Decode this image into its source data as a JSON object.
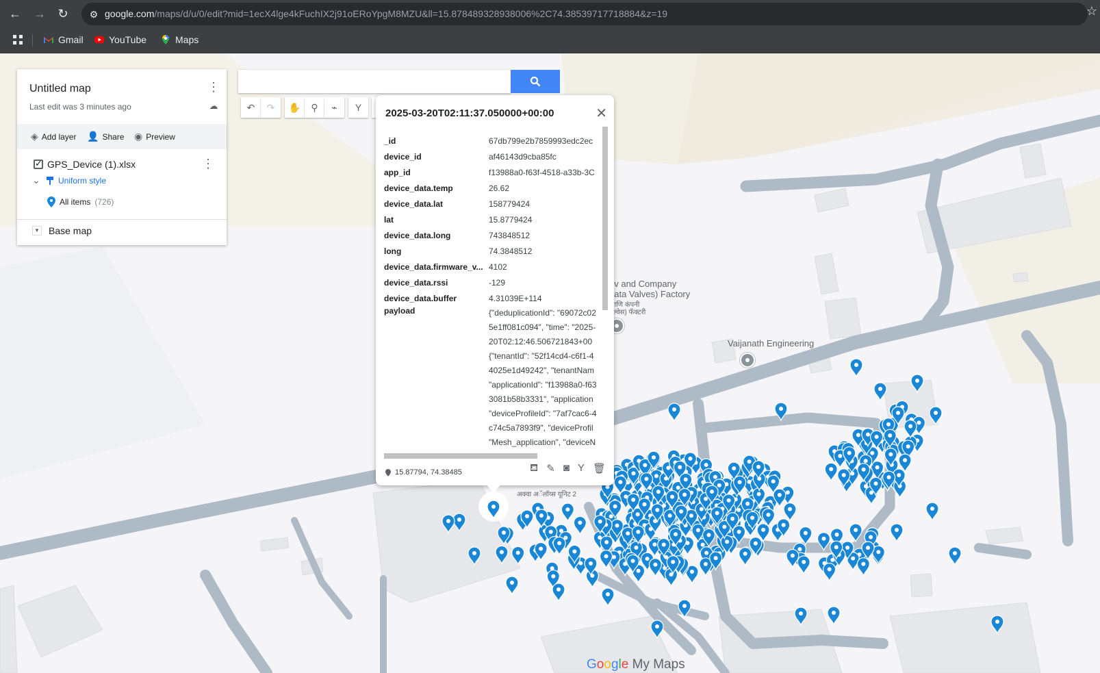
{
  "browser": {
    "url_host": "google.com",
    "url_rest": "/maps/d/u/0/edit?mid=1ecX4lge4kFuchIX2j91oERoYpgM8MZU&ll=15.878489328938006%2C74.38539717718884&z=19",
    "bookmarks": [
      {
        "label": "Gmail",
        "icon": "gmail-icon"
      },
      {
        "label": "YouTube",
        "icon": "youtube-icon"
      },
      {
        "label": "Maps",
        "icon": "maps-icon"
      }
    ]
  },
  "panel": {
    "title": "Untitled map",
    "subtitle": "Last edit was 3 minutes ago",
    "add_layer": "Add layer",
    "share": "Share",
    "preview": "Preview",
    "layer_name": "GPS_Device (1).xlsx",
    "style": "Uniform style",
    "all_items": "All items",
    "item_count": "(726)",
    "base_map": "Base map"
  },
  "search": {
    "placeholder": ""
  },
  "popup": {
    "title": "2025-03-20T02:11:37.050000+00:00",
    "fields": [
      {
        "key": "_id",
        "value": "67db799e2b7859993edc2ec"
      },
      {
        "key": "device_id",
        "value": "af46143d9cba85fc"
      },
      {
        "key": "app_id",
        "value": "f13988a0-f63f-4518-a33b-3C"
      },
      {
        "key": "device_data.temp",
        "value": "26.62"
      },
      {
        "key": "device_data.lat",
        "value": "158779424"
      },
      {
        "key": "lat",
        "value": "15.8779424"
      },
      {
        "key": "device_data.long",
        "value": "743848512"
      },
      {
        "key": "long",
        "value": "74.3848512"
      },
      {
        "key": "device_data.firmware_v...",
        "value": "4102"
      },
      {
        "key": "device_data.rssi",
        "value": "-129"
      },
      {
        "key": "device_data.buffer",
        "value": "4.31039E+114"
      }
    ],
    "payload_key": "payload",
    "payload_lines": [
      "{\"deduplicationId\": \"69072c02",
      "5e1ff081c094\", \"time\": \"2025-",
      "20T02:12:46.506721843+00",
      "{\"tenantId\": \"52f14cd4-c6f1-4",
      "4025e1d49242\", \"tenantNam",
      "\"applicationId\": \"f13988a0-f63",
      "3081b58b3331\", \"application",
      "\"deviceProfileId\": \"7af7cac6-4",
      "c74c5a7893f9\", \"deviceProfil",
      "\"Mesh_application\", \"deviceN"
    ],
    "coords": "15.87794, 74.38485"
  },
  "map": {
    "labels": {
      "factory_1": "ev and Company",
      "factory_2": "aata Valves) Factory",
      "factory_3": "आणि कंपनी",
      "factory_4": "वल्वेस) फॅक्टरी",
      "engineering": "Vaijanath Engineering",
      "unit": "अक्वा अॅलॉय्स यूनिट 2"
    },
    "brand_google": "Google",
    "brand_mymaps": "My Maps",
    "colors": {
      "marker": "#1a87d6",
      "road": "#aebac6",
      "building": "#e6e7ea",
      "land": "#efece3"
    }
  }
}
